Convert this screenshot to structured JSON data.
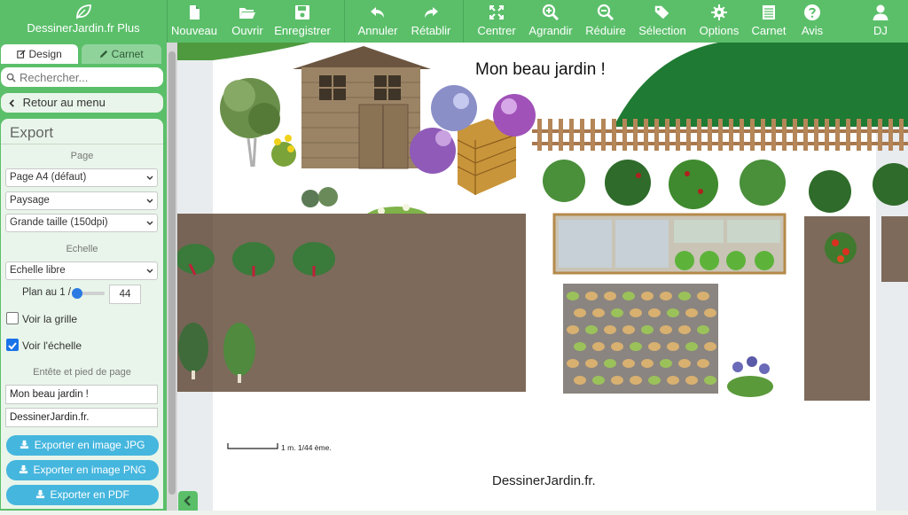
{
  "app": {
    "name": "DessinerJardin.fr Plus"
  },
  "toolbar": {
    "items": [
      {
        "label": "Nouveau",
        "icon": "file-icon"
      },
      {
        "label": "Ouvrir",
        "icon": "folder-open-icon"
      },
      {
        "label": "Enregistrer",
        "icon": "save-icon"
      },
      {
        "label": "Annuler",
        "icon": "undo-icon"
      },
      {
        "label": "Rétablir",
        "icon": "redo-icon"
      },
      {
        "label": "Centrer",
        "icon": "expand-icon"
      },
      {
        "label": "Agrandir",
        "icon": "zoom-in-icon"
      },
      {
        "label": "Réduire",
        "icon": "zoom-out-icon"
      },
      {
        "label": "Sélection",
        "icon": "tags-icon"
      },
      {
        "label": "Options",
        "icon": "gear-icon"
      },
      {
        "label": "Carnet",
        "icon": "notebook-icon"
      },
      {
        "label": "Avis",
        "icon": "question-icon"
      },
      {
        "label": "DJ",
        "icon": "user-icon"
      }
    ]
  },
  "sidebar": {
    "tabs": [
      {
        "label": "Design",
        "active": true
      },
      {
        "label": "Carnet",
        "active": false
      }
    ],
    "search_placeholder": "Rechercher...",
    "back_label": "Retour au menu",
    "export": {
      "title": "Export",
      "page_section": "Page",
      "page_format": "Page A4 (défaut)",
      "orientation": "Paysage",
      "size": "Grande taille (150dpi)",
      "scale_section": "Echelle",
      "scale_mode": "Echelle libre",
      "plan_label": "Plan au 1 /",
      "plan_value": "44",
      "plan_slider_fraction": 0.15,
      "show_grid_label": "Voir la grille",
      "show_grid": false,
      "show_scale_label": "Voir l'échelle",
      "show_scale": true,
      "header_footer_section": "Entête et pied de page",
      "header_text": "Mon beau jardin !",
      "footer_text": "DessinerJardin.fr.",
      "btn_jpg": "Exporter en image JPG",
      "btn_png": "Exporter en image PNG",
      "btn_pdf": "Exporter en PDF"
    }
  },
  "canvas": {
    "title": "Mon beau jardin !",
    "footer": "DessinerJardin.fr.",
    "scale_text": "1 m. 1/44 ème."
  },
  "colors": {
    "brand_green": "#5bbf6a",
    "accent_blue": "#45b6de",
    "soil": "#7d6a5b",
    "lawn": "#1f7a33"
  }
}
